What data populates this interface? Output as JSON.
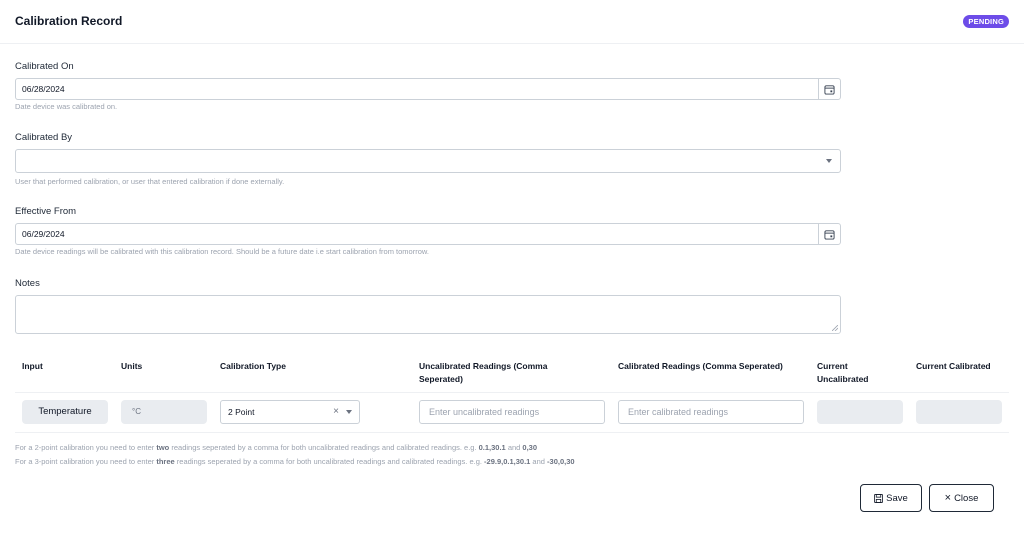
{
  "header": {
    "title": "Calibration Record",
    "status": "PENDING"
  },
  "form": {
    "calibrated_on": {
      "label": "Calibrated On",
      "value": "06/28/2024",
      "help": "Date device was calibrated on."
    },
    "calibrated_by": {
      "label": "Calibrated By",
      "value": "",
      "help": "User that performed calibration, or user that entered calibration if done externally."
    },
    "effective_from": {
      "label": "Effective From",
      "value": "06/29/2024",
      "help": "Date device readings will be calibrated with this calibration record. Should be a future date i.e start calibration from tomorrow."
    },
    "notes": {
      "label": "Notes",
      "value": ""
    }
  },
  "table": {
    "headers": {
      "input": "Input",
      "units": "Units",
      "calibration_type": "Calibration Type",
      "uncalibrated_line1": "Uncalibrated Readings (Comma",
      "uncalibrated_line2": "Seperated)",
      "calibrated": "Calibrated Readings (Comma Seperated)",
      "current_uncal_line1": "Current",
      "current_uncal_line2": "Uncalibrated",
      "current_calibrated": "Current Calibrated"
    },
    "row": {
      "input": "Temperature",
      "units": "°C",
      "calibration_type": "2 Point",
      "uncalibrated_placeholder": "Enter uncalibrated readings",
      "calibrated_placeholder": "Enter calibrated readings",
      "current_uncalibrated": "",
      "current_calibrated": ""
    }
  },
  "notes": {
    "two_point": {
      "pre": "For a 2-point calibration you need to enter ",
      "count": "two",
      "mid": " readings seperated by a comma for both uncalibrated readings and calibrated readings. e.g. ",
      "ex1": "0.1,30.1",
      "and": " and ",
      "ex2": "0,30"
    },
    "three_point": {
      "pre": "For a 3-point calibration you need to enter ",
      "count": "three",
      "mid": " readings seperated by a comma for both uncalibrated readings and calibrated readings. e.g. ",
      "ex1": "-29.9,0.1,30.1",
      "and": " and ",
      "ex2": "-30,0,30"
    }
  },
  "actions": {
    "save": "Save",
    "close": "Close"
  },
  "icons": {
    "date": "calendar-icon",
    "save": "floppy-disk-icon",
    "close": "close-icon"
  },
  "colors": {
    "badge": "#6d4ce8",
    "border": "#cbd1d8",
    "muted": "#9ca3af"
  }
}
